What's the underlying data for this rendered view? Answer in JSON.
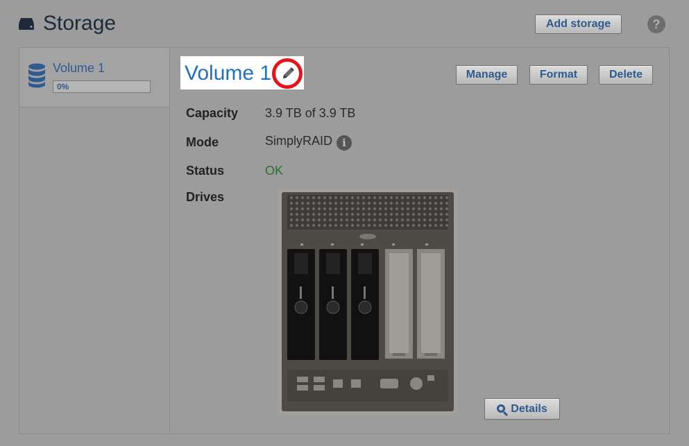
{
  "header": {
    "title": "Storage",
    "add_storage_label": "Add storage",
    "help_label": "?"
  },
  "sidebar": {
    "items": [
      {
        "label": "Volume 1",
        "progress_text": "0%",
        "progress": 0
      }
    ]
  },
  "volume": {
    "title": "Volume 1",
    "actions": {
      "manage": "Manage",
      "format": "Format",
      "delete": "Delete"
    },
    "fields": {
      "capacity_label": "Capacity",
      "capacity_value": "3.9 TB of 3.9 TB",
      "mode_label": "Mode",
      "mode_value": "SimplyRAID",
      "status_label": "Status",
      "status_value": "OK",
      "drives_label": "Drives"
    },
    "drives": {
      "installed": 3,
      "bays": 5
    },
    "details_label": "Details"
  },
  "colors": {
    "link_blue": "#1f6fc4",
    "button_text": "#2f5a8e",
    "status_ok": "#2e6e2e",
    "highlight_ring": "#e3141b"
  }
}
